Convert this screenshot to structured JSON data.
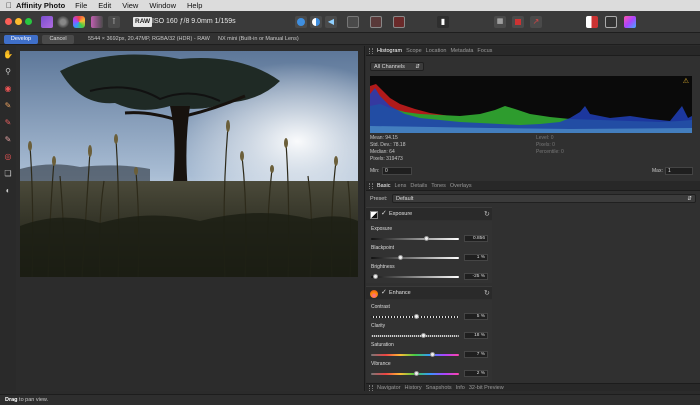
{
  "menubar": {
    "app": "Affinity Photo",
    "items": [
      "File",
      "Edit",
      "View",
      "Window",
      "Help"
    ]
  },
  "toolbar": {
    "raw_badge": "RAW",
    "exif": "ISO 160 ƒ/8 9.0mm 1/159s",
    "icons": [
      "persona-photo-icon",
      "persona-liquify-icon",
      "persona-develop-icon",
      "persona-tone-mapping-icon",
      "persona-export-icon"
    ]
  },
  "context": {
    "develop_label": "Develop",
    "cancel_label": "Cancel",
    "image_info": "5544 × 3692px, 20.47MP, RGBA/32 (HDR) - RAW",
    "lens_info": "NX mini (Built-in or Manual Lens)"
  },
  "histogram_panel": {
    "tabs": [
      "Histogram",
      "Scope",
      "Location",
      "Metadata",
      "Focus"
    ],
    "active_tab": "Histogram",
    "channel": "All Channels",
    "stats_left": [
      "Mean: 94.15",
      "Std. Dev.: 78.18",
      "Median: 64",
      "Pixels: 319473"
    ],
    "stats_right": [
      "Level: 0",
      "Pixels: 0",
      "Percentile: 0"
    ],
    "min_label": "Min:",
    "min_value": "0",
    "max_label": "Max:",
    "max_value": "1",
    "warning": "⚠"
  },
  "adjust_panel": {
    "tabs": [
      "Basic",
      "Lens",
      "Details",
      "Tones",
      "Overlays"
    ],
    "active_tab": "Basic",
    "preset_label": "Preset:",
    "preset_value": "Default",
    "exposure_section": {
      "title": "Exposure",
      "checked": "✓",
      "sliders": [
        {
          "label": "Exposure",
          "value": "0.856",
          "level": 0.63
        },
        {
          "label": "Blackpoint",
          "value": "1 %",
          "level": 0.33
        },
        {
          "label": "Brightness",
          "value": "-25 %",
          "level": 0.05
        }
      ]
    },
    "enhance_section": {
      "title": "Enhance",
      "checked": "✓",
      "sliders": [
        {
          "label": "Contrast",
          "value": "5 %",
          "level": 0.52
        },
        {
          "label": "Clarity",
          "value": "18 %",
          "level": 0.6
        },
        {
          "label": "Saturation",
          "value": "7 %",
          "level": 0.7
        },
        {
          "label": "Vibrance",
          "value": "2 %",
          "level": 0.52
        }
      ]
    }
  },
  "bottom_tabs": [
    "Navigator",
    "History",
    "Snapshots",
    "Info",
    "32-bit Preview"
  ],
  "status": {
    "bold": "Drag",
    "text": " to pan view."
  }
}
